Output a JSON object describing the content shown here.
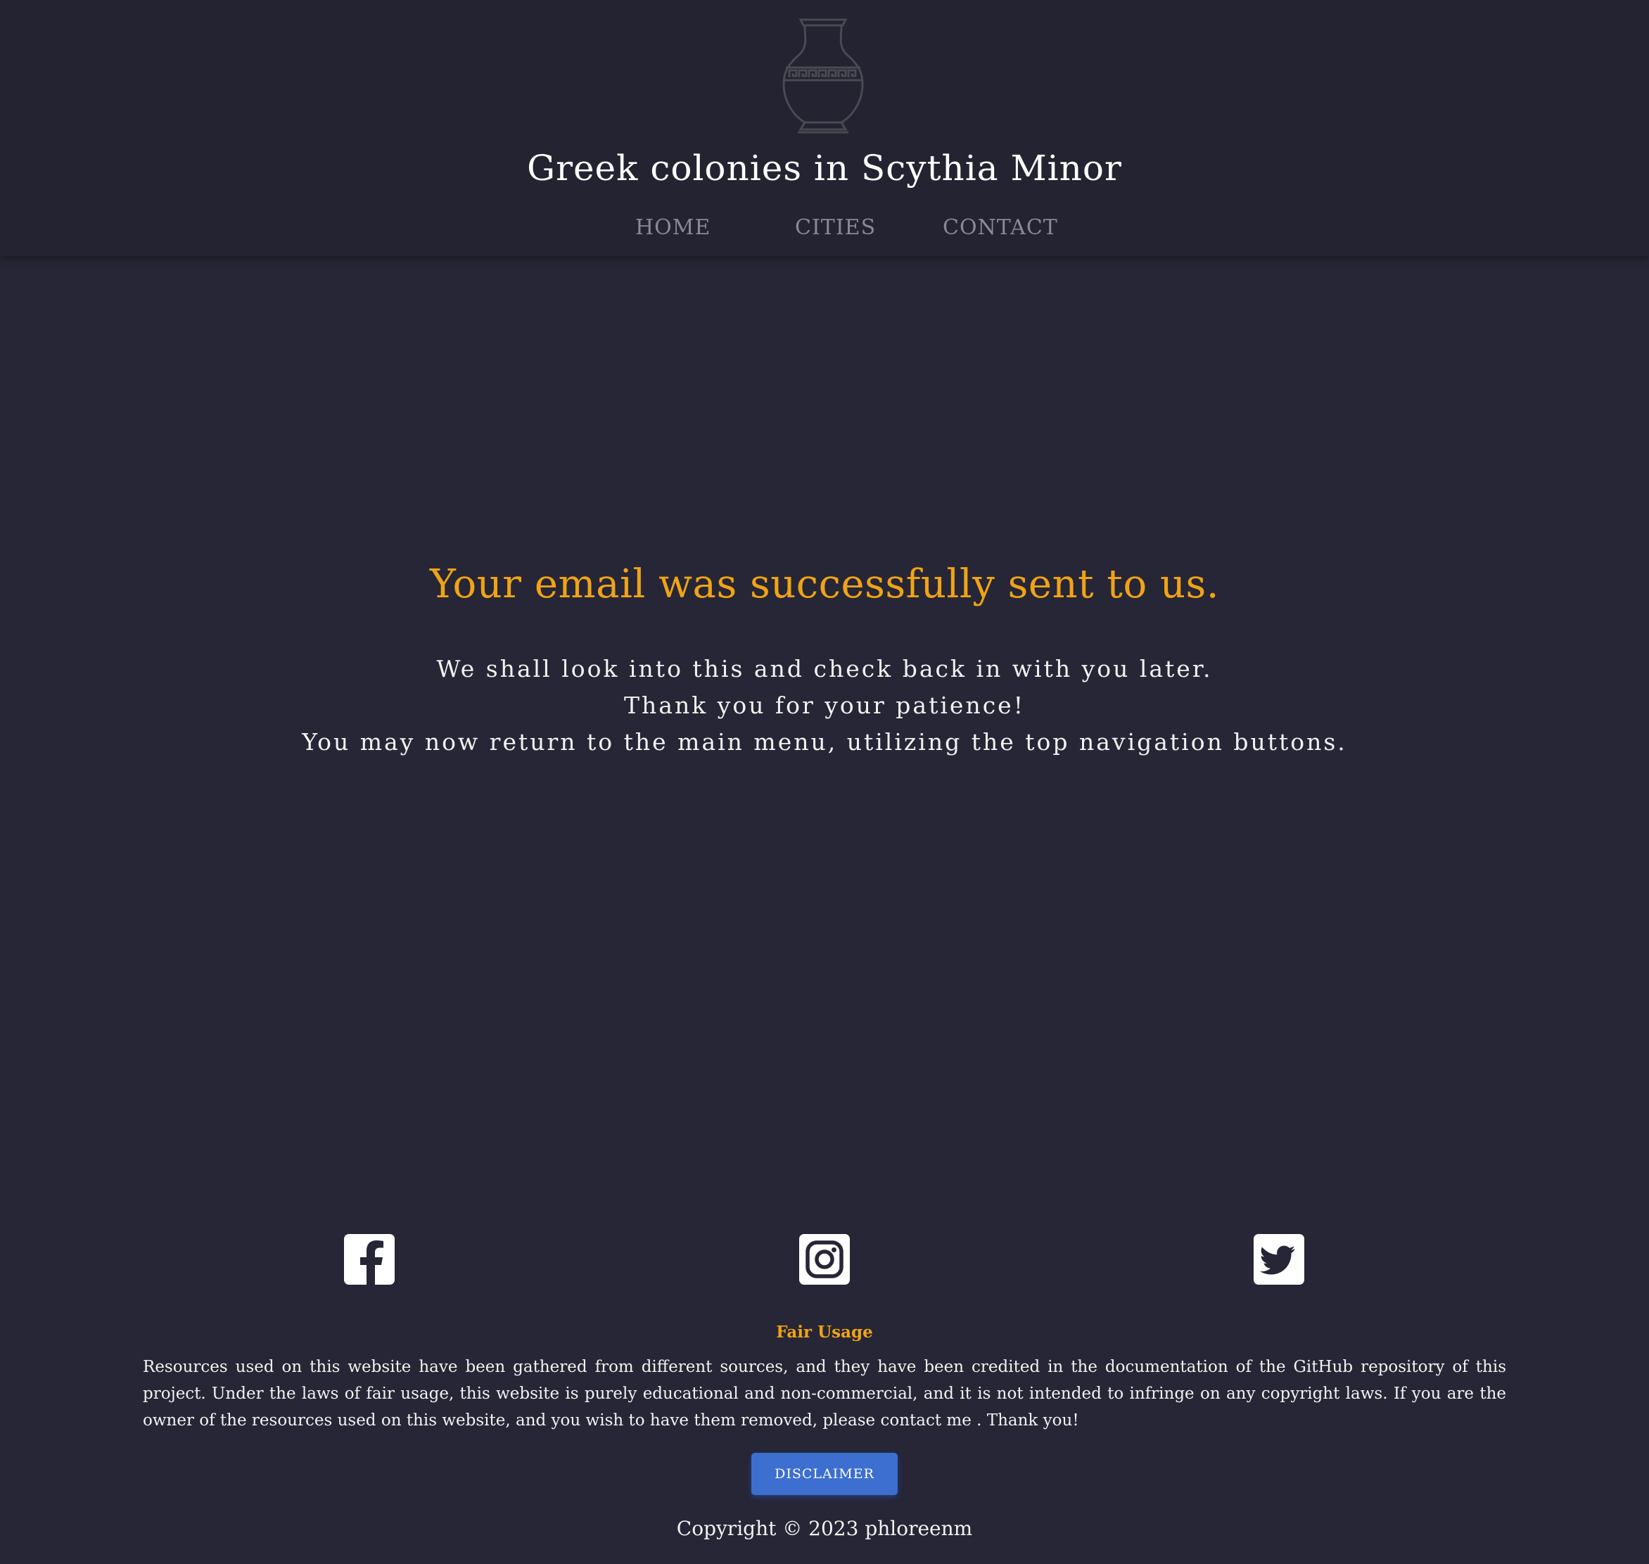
{
  "header": {
    "logo_icon": "greek-vase-icon",
    "title": "Greek colonies in Scythia Minor",
    "nav": [
      {
        "label": "HOME"
      },
      {
        "label": "CITIES"
      },
      {
        "label": "CONTACT"
      }
    ]
  },
  "main": {
    "heading": "Your email was successfully sent to us.",
    "lines": [
      "We shall look into this and check back in with you later.",
      "Thank you for your patience!",
      "You may now return to the main menu, utilizing the top navigation buttons."
    ]
  },
  "footer": {
    "social": [
      {
        "icon": "facebook-icon"
      },
      {
        "icon": "instagram-icon"
      },
      {
        "icon": "twitter-icon"
      }
    ],
    "fair_usage_title": "Fair Usage",
    "fair_usage_text": "Resources used on this website have been gathered from different sources, and they have been credited in the documentation of the GitHub repository of this project. Under the laws of fair usage, this website is purely educational and non-commercial, and it is not intended to infringe on any copyright laws. If you are the owner of the resources used on this website, and you wish to have them removed, please contact me . Thank you!",
    "disclaimer_label": "DISCLAIMER",
    "copyright": "Copyright © 2023 phloreenm"
  },
  "colors": {
    "background": "#262636",
    "header_background": "#232332",
    "accent": "#f0a316",
    "button": "#3c6fd0",
    "nav_text": "#8a8a96"
  }
}
